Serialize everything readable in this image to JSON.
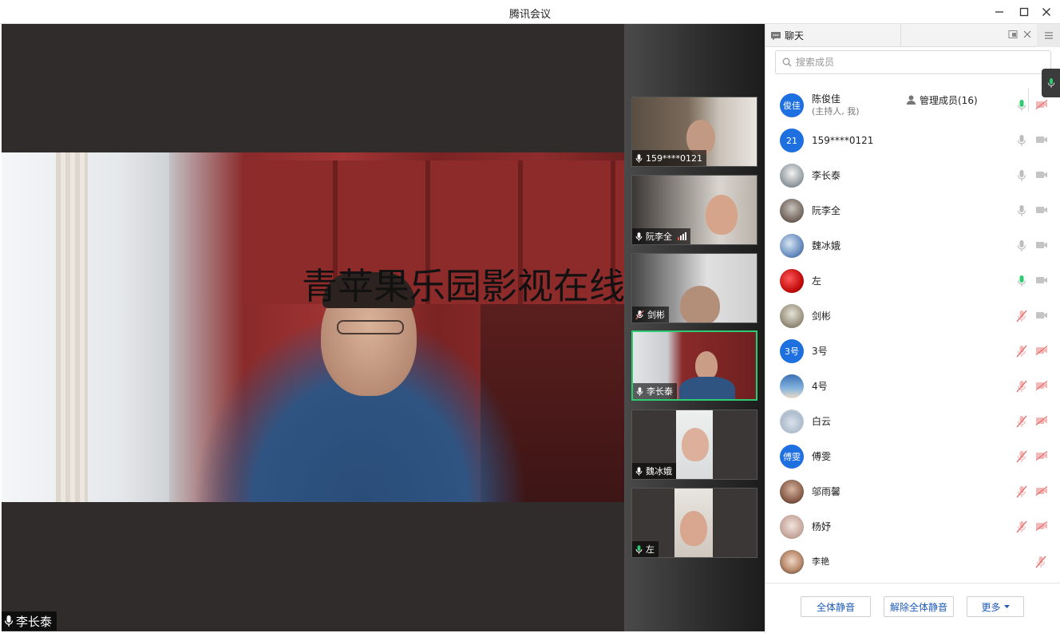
{
  "window": {
    "title": "腾讯会议"
  },
  "stage": {
    "watermark": "青苹果乐园影视在线播放",
    "active_speaker": "李长泰"
  },
  "thumbnails": [
    {
      "name": "159****0121",
      "mic": "on",
      "active": false
    },
    {
      "name": "阮李全",
      "mic": "on",
      "active": false,
      "signal": true
    },
    {
      "name": "剑彬",
      "mic": "muted",
      "active": false
    },
    {
      "name": "李长泰",
      "mic": "on",
      "active": true
    },
    {
      "name": "魏冰娥",
      "mic": "on",
      "active": false
    },
    {
      "name": "左",
      "mic": "speaking",
      "active": false
    }
  ],
  "panel": {
    "tab_chat": "聊天",
    "tab_members": "管理成员(16)",
    "search_placeholder": "搜索成员",
    "members": [
      {
        "name": "陈俊佳",
        "sub": "(主持人, 我)",
        "avatar_text": "俊佳",
        "mic": "speaking",
        "cam": "muted"
      },
      {
        "name": "159****0121",
        "sub": "",
        "avatar_text": "21",
        "mic": "on",
        "cam": "on"
      },
      {
        "name": "李长泰",
        "sub": "",
        "avatar_text": "",
        "mic": "on",
        "cam": "on"
      },
      {
        "name": "阮李全",
        "sub": "",
        "avatar_text": "",
        "mic": "on",
        "cam": "on"
      },
      {
        "name": "魏冰娥",
        "sub": "",
        "avatar_text": "",
        "mic": "on",
        "cam": "on"
      },
      {
        "name": "左",
        "sub": "",
        "avatar_text": "",
        "mic": "speaking",
        "cam": "on"
      },
      {
        "name": "剑彬",
        "sub": "",
        "avatar_text": "",
        "mic": "muted",
        "cam": "on"
      },
      {
        "name": "3号",
        "sub": "",
        "avatar_text": "3号",
        "mic": "muted",
        "cam": "muted"
      },
      {
        "name": "4号",
        "sub": "",
        "avatar_text": "",
        "mic": "muted",
        "cam": "muted"
      },
      {
        "name": "白云",
        "sub": "",
        "avatar_text": "",
        "mic": "muted",
        "cam": "muted"
      },
      {
        "name": "傅雯",
        "sub": "",
        "avatar_text": "傅雯",
        "mic": "muted",
        "cam": "muted"
      },
      {
        "name": "邬雨馨",
        "sub": "",
        "avatar_text": "",
        "mic": "muted",
        "cam": "muted"
      },
      {
        "name": "杨妤",
        "sub": "",
        "avatar_text": "",
        "mic": "muted",
        "cam": "muted"
      },
      {
        "name": "李艳",
        "sub": "",
        "avatar_text": "",
        "mic": "muted",
        "cam": "none"
      }
    ],
    "buttons": {
      "mute_all": "全体静音",
      "unmute_all": "解除全体静音",
      "more": "更多"
    }
  },
  "colors": {
    "accent": "#1e5bb8",
    "speaking": "#2ecc71",
    "muted": "#e57373",
    "avatar_blue": "#1e6fe0"
  }
}
